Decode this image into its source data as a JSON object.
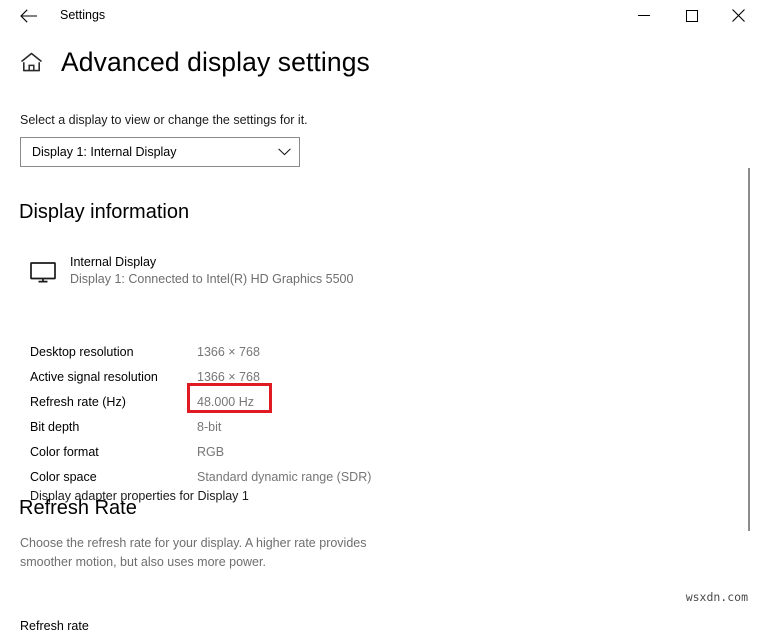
{
  "titlebar": {
    "back_icon": "back-arrow-icon",
    "title": "Settings",
    "minimize_icon": "minimize-icon",
    "maximize_icon": "maximize-icon",
    "close_icon": "close-icon"
  },
  "page": {
    "home_icon": "home-icon",
    "title": "Advanced display settings",
    "select_hint": "Select a display to view or change the settings for it."
  },
  "display_select": {
    "value": "Display 1: Internal Display",
    "chevron_icon": "chevron-down-icon"
  },
  "display_information": {
    "heading": "Display information",
    "monitor_icon": "monitor-icon",
    "monitor_name": "Internal Display",
    "monitor_sub": "Display 1: Connected to Intel(R) HD Graphics 5500",
    "rows": [
      {
        "label": "Desktop resolution",
        "value": "1366 × 768"
      },
      {
        "label": "Active signal resolution",
        "value": "1366 × 768"
      },
      {
        "label": "Refresh rate (Hz)",
        "value": "48.000 Hz"
      },
      {
        "label": "Bit depth",
        "value": "8-bit"
      },
      {
        "label": "Color format",
        "value": "RGB"
      },
      {
        "label": "Color space",
        "value": "Standard dynamic range (SDR)"
      }
    ],
    "adapter_link": "Display adapter properties for Display 1"
  },
  "annotation": {
    "highlight_color": "#e01b24",
    "highlight_target": "Refresh rate (Hz) value"
  },
  "refresh_rate": {
    "heading": "Refresh Rate",
    "description": "Choose the refresh rate for your display. A higher rate provides smoother motion, but also uses more power.",
    "field_label": "Refresh rate"
  },
  "scrollbar": {
    "orientation": "vertical"
  },
  "watermark": {
    "text": "wsxdn.com"
  }
}
